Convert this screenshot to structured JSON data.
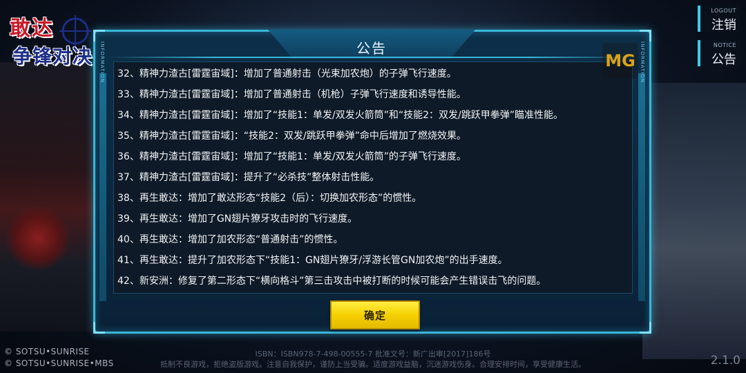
{
  "logo": {
    "line1": "敢达",
    "line2": "争锋对决"
  },
  "side_buttons": [
    {
      "en": "LOGOUT",
      "cn": "注销"
    },
    {
      "en": "NOTICE",
      "cn": "公告"
    }
  ],
  "badge": "MG",
  "dialog": {
    "title": "公告",
    "rail_left": "INFORMATION",
    "rail_right": "INFORMATION",
    "items": [
      "32、精神力渣古[雷霆宙域]：增加了普通射击（光束加农炮）的子弹飞行速度。",
      "33、精神力渣古[雷霆宙域]：增加了普通射击（机枪）子弹飞行速度和诱导性能。",
      "34、精神力渣古[雷霆宙域]：增加了“技能1：单发/双发火箭筒”和“技能2：双发/跳跃甲拳弹”瞄准性能。",
      "35、精神力渣古[雷霆宙域]：“技能2：双发/跳跃甲拳弹”命中后增加了燃烧效果。",
      "36、精神力渣古[雷霆宙域]：增加了“技能1：单发/双发火箭筒”的子弹飞行速度。",
      "37、精神力渣古[雷霆宙域]：提升了“必杀技”整体射击性能。",
      "38、再生敢达：增加了敢达形态“技能2（后）：切换加农形态”的惯性。",
      "39、再生敢达：增加了GN翅片獠牙攻击时的飞行速度。",
      "40、再生敢达：增加了加农形态“普通射击”的惯性。",
      "41、再生敢达：提升了加农形态下“技能1：GN翅片獠牙/浮游长管GN加农炮”的出手速度。",
      "42、新安洲：修复了第二形态下“横向格斗”第三击攻击中被打断的时候可能会产生错误击飞的问题。"
    ],
    "confirm_label": "确定"
  },
  "copyright": [
    "© SOTSU•SUNRISE",
    "© SOTSU•SUNRISE•MBS"
  ],
  "footer": {
    "line1": "ISBN：ISBN978-7-498-00555-7  批准文号：新广出审[2017]186号",
    "line2": "抵制不良游戏，拒绝盗版游戏。注意自我保护，谨防上当受骗。适度游戏益脑，沉迷游戏伤身。合理安排时间，享受健康生活。"
  },
  "version": "2.1.0"
}
